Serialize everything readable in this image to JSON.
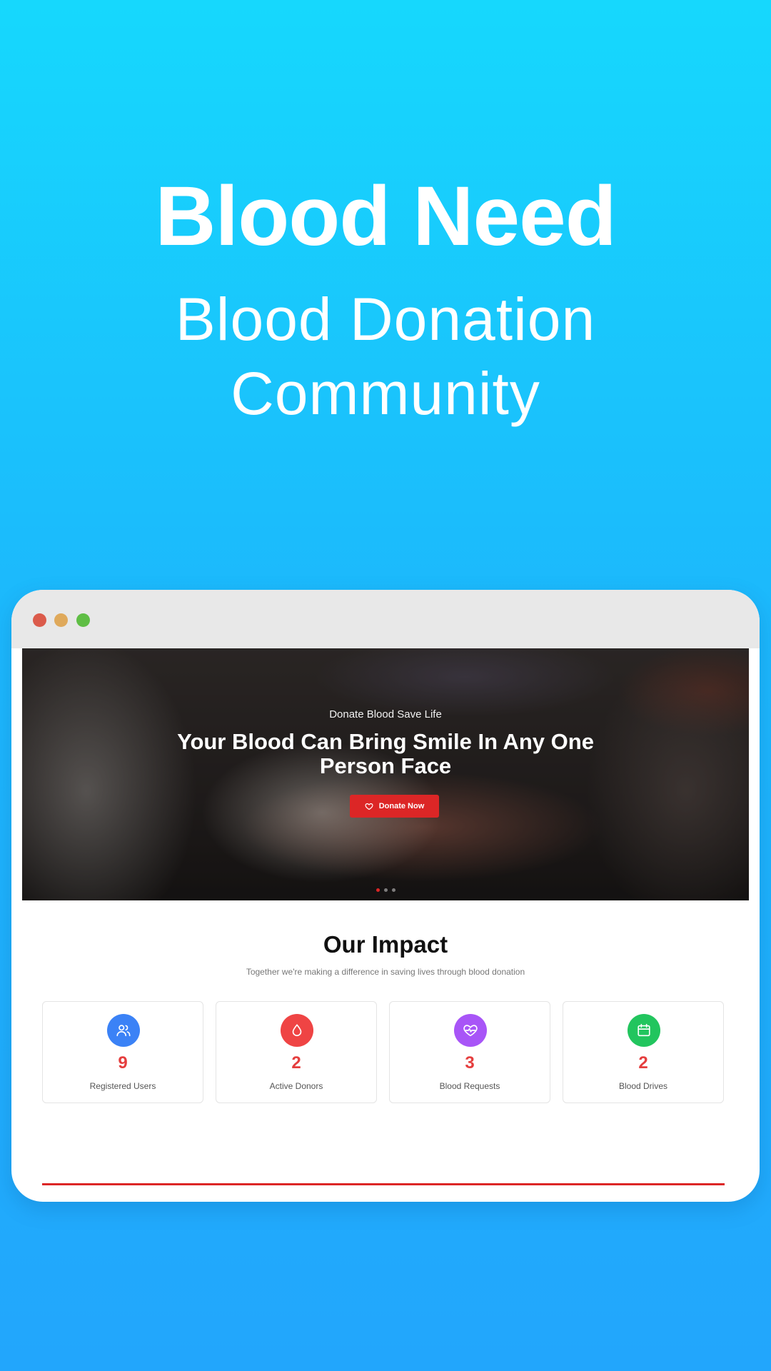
{
  "promo": {
    "title": "Blood Need",
    "subtitle": "Blood Donation Community"
  },
  "hero": {
    "tagline": "Donate Blood Save Life",
    "headline": "Your Blood Can Bring Smile In Any One Person Face",
    "cta_label": "Donate Now",
    "slides": 3,
    "active_slide": 1
  },
  "impact": {
    "title": "Our Impact",
    "subtitle": "Together we're making a difference in saving lives through blood donation",
    "stats": [
      {
        "value": "9",
        "label": "Registered Users",
        "icon": "users-icon",
        "color": "#3b82f6"
      },
      {
        "value": "2",
        "label": "Active Donors",
        "icon": "blood-drop-icon",
        "color": "#ef4444"
      },
      {
        "value": "3",
        "label": "Blood Requests",
        "icon": "heart-pulse-icon",
        "color": "#a855f7"
      },
      {
        "value": "2",
        "label": "Blood Drives",
        "icon": "calendar-icon",
        "color": "#22c55e"
      }
    ]
  },
  "colors": {
    "accent": "#dc2626",
    "stat_value": "#e53e3e",
    "background_top": "#16d8fd",
    "background_bottom": "#22a6fc"
  }
}
